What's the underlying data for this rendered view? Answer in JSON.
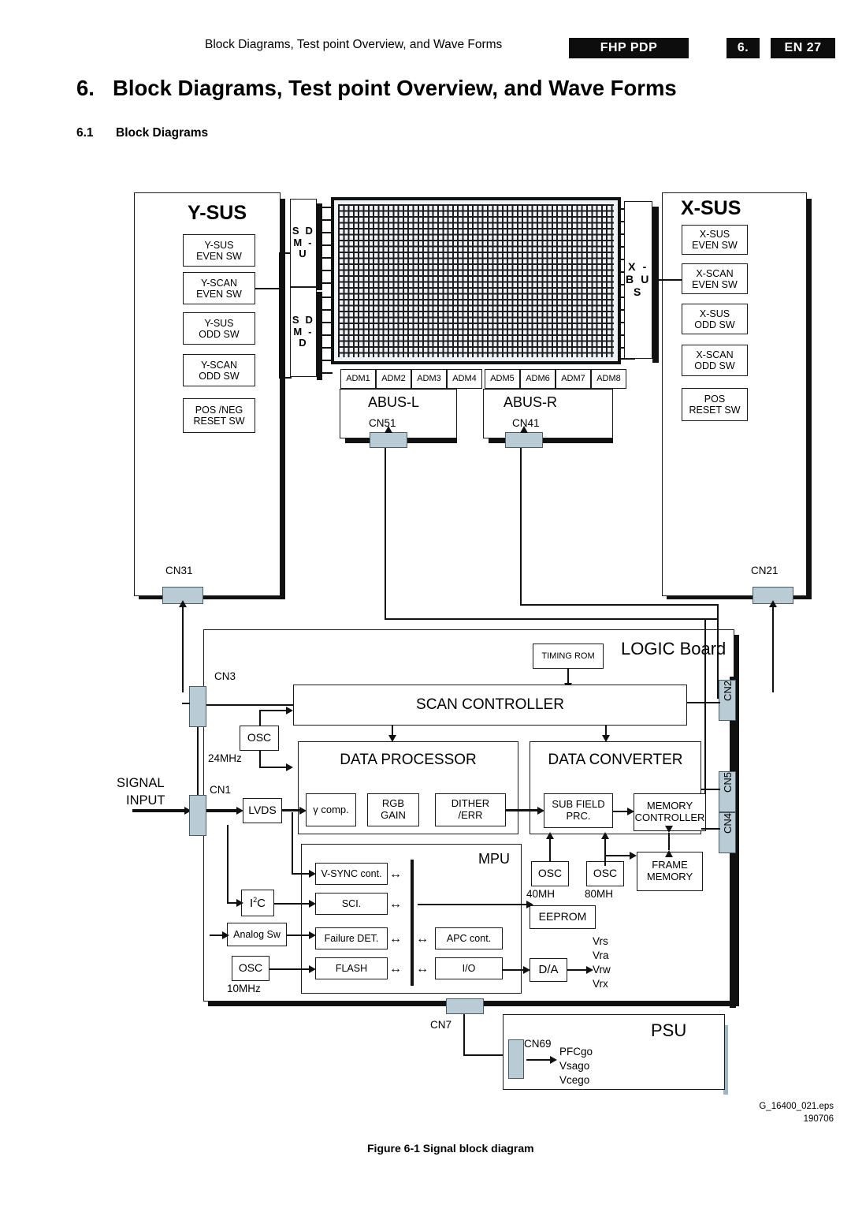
{
  "header": {
    "running_title": "Block Diagrams, Test point Overview, and Wave Forms",
    "model_badge": "FHP PDP",
    "chapter_badge": "6.",
    "page_badge": "EN 27"
  },
  "headings": {
    "chapter_number": "6.",
    "chapter_title": "Block Diagrams, Test point Overview, and Wave Forms",
    "section_number": "6.1",
    "section_title": "Block Diagrams"
  },
  "diagram": {
    "ysus": {
      "title": "Y-SUS",
      "blocks": [
        {
          "l1": "Y-SUS",
          "l2": "EVEN SW"
        },
        {
          "l1": "Y-SCAN",
          "l2": "EVEN SW"
        },
        {
          "l1": "Y-SUS",
          "l2": "ODD SW"
        },
        {
          "l1": "Y-SCAN",
          "l2": "ODD SW"
        },
        {
          "l1": "POS /NEG",
          "l2": "RESET SW"
        }
      ],
      "connector": "CN31"
    },
    "xsus": {
      "title": "X-SUS",
      "blocks": [
        {
          "l1": "X-SUS",
          "l2": "EVEN SW"
        },
        {
          "l1": "X-SCAN",
          "l2": "EVEN SW"
        },
        {
          "l1": "X-SUS",
          "l2": "ODD SW"
        },
        {
          "l1": "X-SCAN",
          "l2": "ODD SW"
        },
        {
          "l1": "POS",
          "l2": "RESET SW"
        }
      ],
      "connector": "CN21"
    },
    "buses": {
      "sdm_u": "S D M - U",
      "sdm_d": "S D M - D",
      "xbus": "X - B U S"
    },
    "adm": [
      "ADM1",
      "ADM2",
      "ADM3",
      "ADM4",
      "ADM5",
      "ADM6",
      "ADM7",
      "ADM8"
    ],
    "abus_l": {
      "title": "ABUS-L",
      "connector": "CN51"
    },
    "abus_r": {
      "title": "ABUS-R",
      "connector": "CN41"
    },
    "logic": {
      "title": "LOGIC Board",
      "timing_rom": "TIMING ROM",
      "scan_controller": "SCAN CONTROLLER",
      "data_processor": {
        "title": "DATA PROCESSOR",
        "blocks": [
          {
            "l1": "γ comp.",
            "l2": ""
          },
          {
            "l1": "RGB",
            "l2": "GAIN"
          },
          {
            "l1": "DITHER",
            "l2": "/ERR"
          }
        ]
      },
      "data_converter": {
        "title": "DATA CONVERTER",
        "sub_field": {
          "l1": "SUB FIELD",
          "l2": "PRC."
        },
        "memory_controller": {
          "l1": "MEMORY",
          "l2": "CONTROLLER"
        },
        "frame_memory": {
          "l1": "FRAME",
          "l2": "MEMORY"
        },
        "osc_a": "OSC",
        "osc_a_freq": "40MH",
        "osc_b": "OSC",
        "osc_b_freq": "80MH"
      },
      "mpu": {
        "title": "MPU",
        "left_col": [
          "V-SYNC cont.",
          "SCI.",
          "Failure DET.",
          "FLASH"
        ],
        "right_col": [
          "APC cont.",
          "I/O"
        ]
      },
      "lvds": "LVDS",
      "i2c": "I2C",
      "analog_sw": "Analog Sw",
      "osc_sys": "OSC",
      "osc_sys_freq": "24MHz",
      "osc_mpu": "OSC",
      "osc_mpu_freq": "10MHz",
      "eeprom": "EEPROM",
      "da": "D/A",
      "da_outputs": [
        "Vrs",
        "Vra",
        "Vrw",
        "Vrx"
      ],
      "signal_input_l1": "SIGNAL",
      "signal_input_l2": "INPUT",
      "connectors": [
        "CN3",
        "CN1",
        "CN2",
        "CN5",
        "CN4",
        "CN7"
      ]
    },
    "psu": {
      "title": "PSU",
      "connector": "CN69",
      "outputs": [
        "PFCgo",
        "Vsago",
        "Vcego"
      ]
    }
  },
  "footer": {
    "eps_name": "G_16400_021.eps",
    "eps_date": "190706",
    "figure_caption": "Figure 6-1 Signal block diagram"
  }
}
